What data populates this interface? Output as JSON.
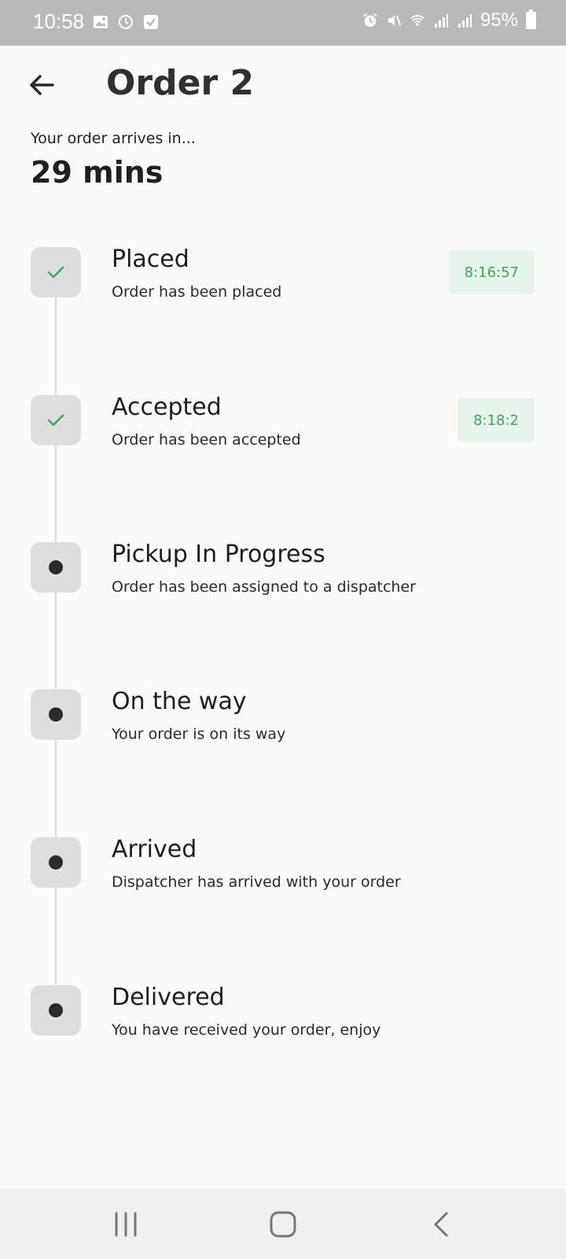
{
  "status_bar": {
    "time": "10:58",
    "battery": "95%"
  },
  "header": {
    "title": "Order 2"
  },
  "eta": {
    "label": "Your order arrives in...",
    "value": "29 mins"
  },
  "steps": [
    {
      "title": "Placed",
      "desc": "Order has been placed",
      "time": "8:16:57",
      "done": true
    },
    {
      "title": "Accepted",
      "desc": "Order has been accepted",
      "time": "8:18:2",
      "done": true
    },
    {
      "title": "Pickup In Progress",
      "desc": "Order has been assigned to a dispatcher",
      "done": false
    },
    {
      "title": "On the way",
      "desc": "Your order is on its way",
      "done": false
    },
    {
      "title": "Arrived",
      "desc": "Dispatcher has arrived with your order",
      "done": false
    },
    {
      "title": "Delivered",
      "desc": "You have received your order, enjoy",
      "done": false
    }
  ],
  "colors": {
    "accent": "#43a35d",
    "badge_bg": "#e6f3ea",
    "node_bg": "#dedede"
  },
  "icons": {
    "back": "arrow-left-icon",
    "check": "check-icon",
    "recents": "recents-icon",
    "home": "home-icon",
    "nav_back": "chevron-left-icon"
  }
}
